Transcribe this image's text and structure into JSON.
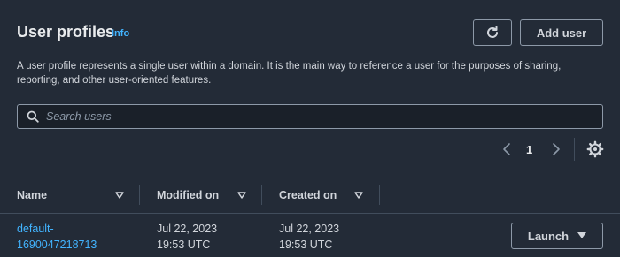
{
  "header": {
    "title": "User profiles",
    "info_label": "Info",
    "add_user_label": "Add user",
    "refresh_icon": "refresh-icon"
  },
  "description": "A user profile represents a single user within a domain. It is the main way to reference a user for the purposes of sharing, reporting, and other user-oriented features.",
  "search": {
    "placeholder": "Search users",
    "value": ""
  },
  "pagination": {
    "current_page": "1"
  },
  "table": {
    "columns": [
      {
        "label": "Name"
      },
      {
        "label": "Modified on"
      },
      {
        "label": "Created on"
      }
    ],
    "rows": [
      {
        "name_line1": "default-",
        "name_line2": "1690047218713",
        "modified_date": "Jul 22, 2023",
        "modified_time": "19:53 UTC",
        "created_date": "Jul 22, 2023",
        "created_time": "19:53 UTC",
        "action_label": "Launch"
      }
    ]
  },
  "colors": {
    "background": "#232b37",
    "link": "#42b4ff",
    "border": "#8d99a8",
    "text": "#d1d5db"
  }
}
